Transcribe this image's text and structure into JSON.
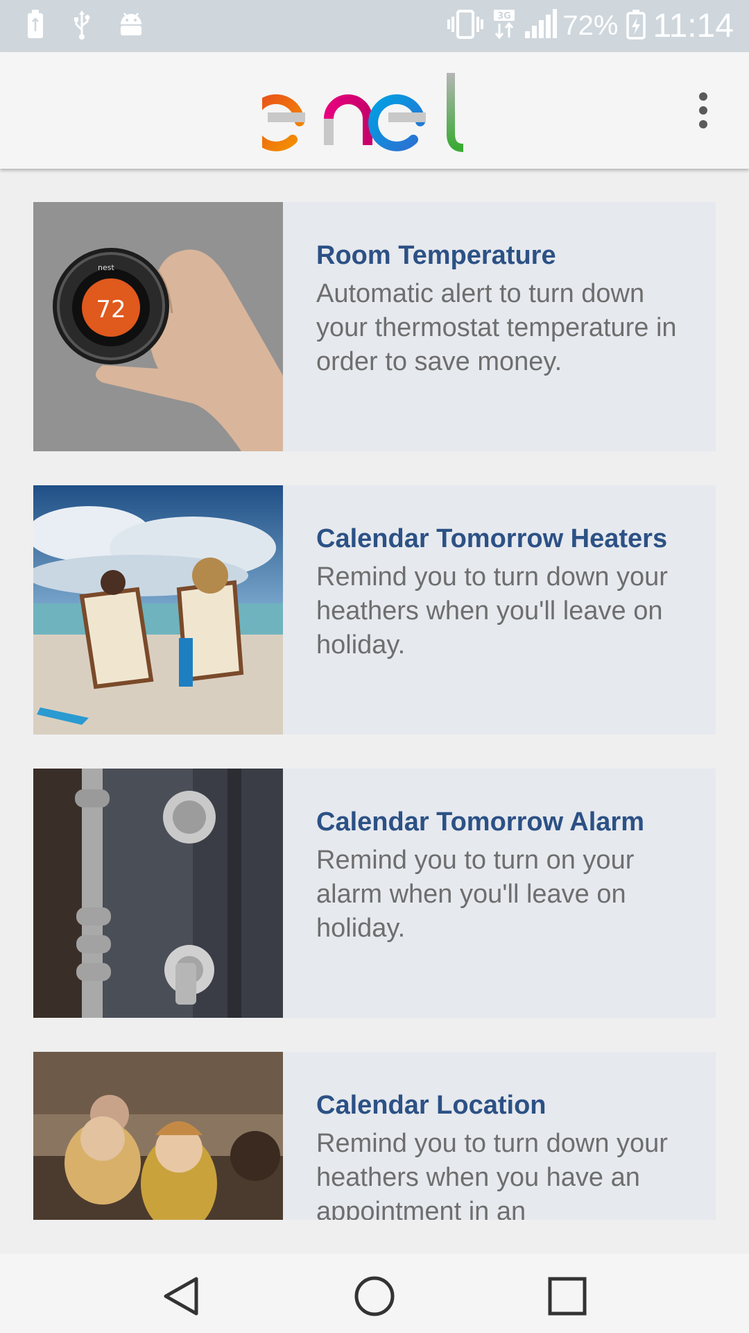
{
  "status_bar": {
    "left_icons": [
      "battery-usb-icon",
      "usb-icon",
      "android-icon"
    ],
    "right_icons": [
      "vibrate-icon",
      "data-3g-icon",
      "signal-icon"
    ],
    "network": "3G",
    "battery_percent": "72%",
    "time": "11:14"
  },
  "app_bar": {
    "logo_text": "enel",
    "menu_icon": "more-vertical-icon"
  },
  "cards": [
    {
      "title": "Room Temperature",
      "description": "Automatic alert to turn down your thermostat temperature in order to save money.",
      "image": "thermostat-photo",
      "thermostat_brand": "nest",
      "thermostat_value": "72"
    },
    {
      "title": "Calendar Tomorrow Heaters",
      "description": "Remind you to turn down your heathers when you'll leave on holiday.",
      "image": "beach-chairs-photo"
    },
    {
      "title": "Calendar Tomorrow Alarm",
      "description": "Remind you to turn on your alarm when you'll leave on holiday.",
      "image": "door-lock-photo"
    },
    {
      "title": "Calendar Location",
      "description": "Remind you to turn down your heathers when you have an appointment in an",
      "image": "restaurant-people-photo"
    }
  ],
  "nav_bar": {
    "back_icon": "back-triangle-icon",
    "home_icon": "home-circle-icon",
    "recents_icon": "recents-square-icon"
  },
  "colors": {
    "title": "#2c5185",
    "description": "#6e6e6e",
    "card_bg": "#e6e9ee",
    "status_bar": "#cfd7dd"
  }
}
